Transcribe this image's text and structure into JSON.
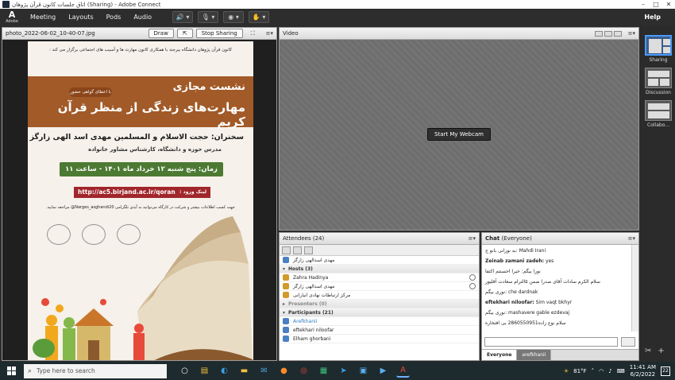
{
  "window": {
    "title": "اتاق جلسات کانون قرآن پژوهان (Sharing) - Adobe Connect"
  },
  "menubar": {
    "logo_letter": "A",
    "logo_text": "Adobe",
    "items": [
      "Meeting",
      "Layouts",
      "Pods",
      "Audio"
    ],
    "help": "Help"
  },
  "share_pod": {
    "title": "photo_2022-06-02_10-40-07.jpg",
    "draw_label": "Draw",
    "stop_sharing_label": "Stop Sharing",
    "poster": {
      "top_text": "کانون قرآن پژوهان دانشگاه بیرجند با همکاری کانون مهارت ها و آسیب های اجتماعی برگزار می کند :",
      "badge": "با اعطای گواهی حضور",
      "banner_line1": "نشست مجازی",
      "banner_line2": "مهارت‌های زندگی از منظر قرآن کریم",
      "speaker": "سخنران: حجت الاسلام و المسلمین مهدی اسد الهی زارگز",
      "role": "مدرس حوزه و دانشگاه، کارشناس مشاور خانواده",
      "time": "زمان: پنج شنبه ۱۲ خرداد ماه ۱۴۰۱ - ساعت ۱۱",
      "link_label": "لینک ورود :",
      "link_url": "http://ac5.birjand.ac.ir/qoran",
      "note": "جهت کسب اطلاعات بیشتر و شرکت در کارگاه می‌توانید به آیدی تلگرامی Narges_asghandi20@ مراجعه نمایید."
    }
  },
  "video_pod": {
    "title": "Video",
    "webcam_label": "Start My Webcam"
  },
  "attendees_pod": {
    "title": "Attendees",
    "count": "(24)",
    "presenter": "مهدی اسدالهی زارگز",
    "hosts_label": "Hosts (3)",
    "hosts": [
      "Zahra Hadinya",
      "مهدی اسدالهی زارگز",
      "مرکز ارتباطات نهادی انیارانی"
    ],
    "presenters_label": "Presenters (0)",
    "participants_label": "Participants (21)",
    "participants": [
      "Arefkhanii",
      "eftekhari niloofar",
      "Elham ghorbani"
    ]
  },
  "chat_pod": {
    "title": "Chat",
    "scope": "(Everyone)",
    "messages": [
      {
        "name": "",
        "text": "به نورانی بانو ج: Mahdi Irani"
      },
      {
        "name": "Zeinab zamani zadeh:",
        "text": "yes"
      },
      {
        "name": "",
        "text": "نورا بیگم: خیرا احسنتم اکتفا"
      },
      {
        "name": "",
        "text": "سلام الکرم سادات آقای صدرا ضمن ۵الترام سعادت آقلیور"
      },
      {
        "name": "",
        "text": "نوری بیگم: che dardnak"
      },
      {
        "name": "eftekhari niloofar:",
        "text": "Sim vaqt bkhyr"
      },
      {
        "name": "",
        "text": "نوری بیگم: mashavere gable ezdevaj"
      },
      {
        "name": "",
        "text": "سلام نوع زاده2860550951 بی افتخاره"
      }
    ],
    "tabs": [
      "Everyone",
      "arefkhanii"
    ]
  },
  "layouts_sidebar": {
    "items": [
      "Sharing",
      "Discussion",
      "Collabo..."
    ]
  },
  "taskbar": {
    "search_placeholder": "Type here to search",
    "weather": "81°F",
    "time": "11:41 AM",
    "date": "6/2/2022",
    "notifications": "22"
  }
}
